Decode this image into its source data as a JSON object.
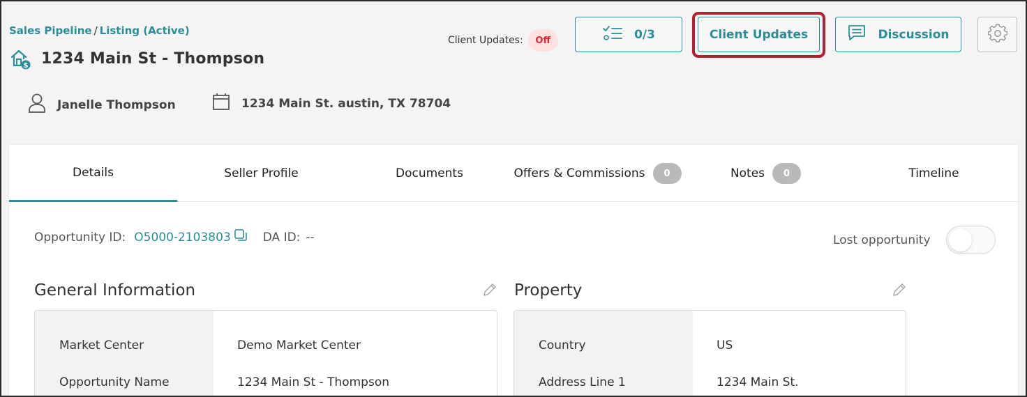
{
  "breadcrumb": {
    "pipeline": "Sales Pipeline",
    "separator": "/",
    "stage": "Listing (Active)"
  },
  "header": {
    "title": "1234 Main St - Thompson",
    "client_updates_label": "Client Updates:",
    "client_updates_status": "Off",
    "tasks_label": "0/3",
    "client_updates_button": "Client Updates",
    "discussion_button": "Discussion",
    "agent_name": "Janelle Thompson",
    "address": "1234 Main St. austin, TX 78704"
  },
  "tabs": [
    {
      "label": "Details",
      "active": true
    },
    {
      "label": "Seller Profile"
    },
    {
      "label": "Documents"
    },
    {
      "label": "Offers & Commissions",
      "count": "0"
    },
    {
      "label": "Notes",
      "count": "0"
    },
    {
      "label": "Timeline"
    }
  ],
  "details": {
    "opportunity_id_label": "Opportunity ID:",
    "opportunity_id": "O5000-2103803",
    "da_id_label": "DA ID:",
    "da_id": "--",
    "lost_opportunity_label": "Lost opportunity",
    "lost_opportunity_on": false
  },
  "general_information": {
    "title": "General Information",
    "rows": [
      {
        "label": "Market Center",
        "value": "Demo Market Center"
      },
      {
        "label": "Opportunity Name",
        "value": "1234 Main St - Thompson"
      }
    ]
  },
  "property": {
    "title": "Property",
    "rows": [
      {
        "label": "Country",
        "value": "US"
      },
      {
        "label": "Address Line 1",
        "value": "1234 Main St."
      }
    ]
  },
  "colors": {
    "accent": "#2a8d98",
    "highlight": "#b3202f",
    "off_badge_bg": "#fde0e0",
    "off_badge_text": "#e0262f"
  },
  "icons": [
    "house-dollar-icon",
    "checklist-icon",
    "chat-icon",
    "gear-icon",
    "person-icon",
    "building-icon",
    "copy-icon",
    "pencil-icon"
  ]
}
